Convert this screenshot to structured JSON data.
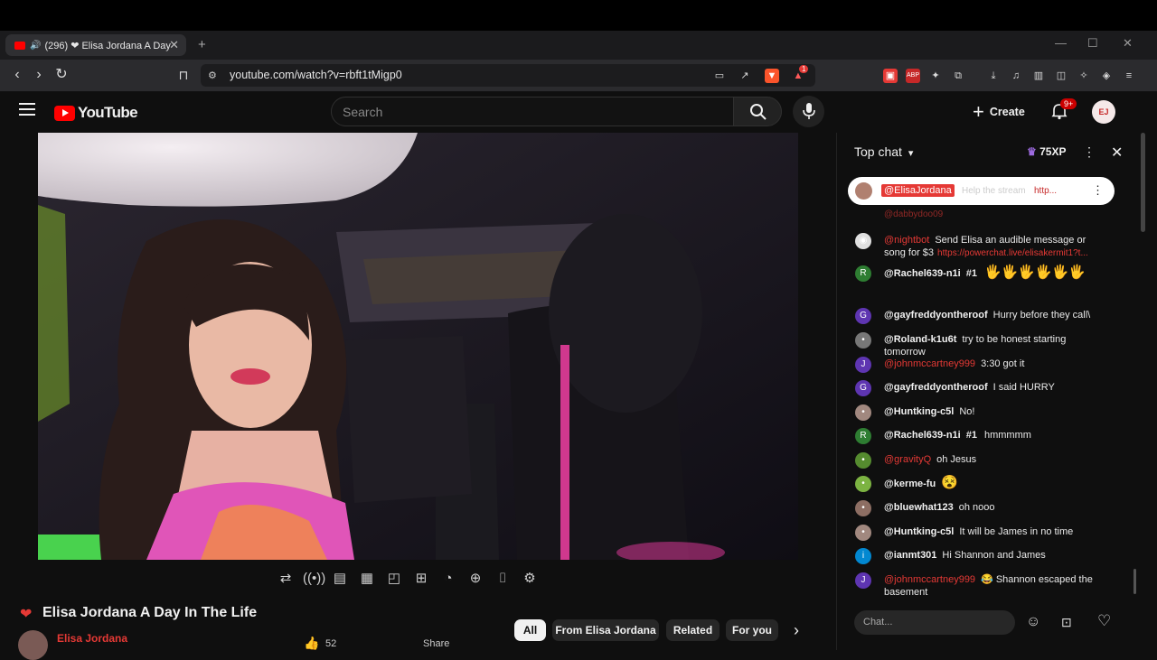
{
  "browser": {
    "tab_title": "(296) ❤ Elisa Jordana A Day",
    "url": "youtube.com/watch?v=rbft1tMigp0",
    "ext_badge": "1"
  },
  "youtube": {
    "logo_text": "YouTube",
    "search_placeholder": "Search",
    "create_label": "Create",
    "notif_badge": "9+",
    "channel_avatar_text": "EJ"
  },
  "video": {
    "title": "Elisa Jordana A Day In The Life",
    "channel_name": "Elisa Jordana",
    "like_count": "52",
    "share_label": "Share"
  },
  "filters": [
    "All",
    "From Elisa Jordana",
    "Related",
    "For you"
  ],
  "chat": {
    "mode_label": "Top chat",
    "xp_label": "75XP",
    "pinned": {
      "author": "@ElisaJordana",
      "text": "Help the stream",
      "link": "http..."
    },
    "partial_top": "@dabbydoo09",
    "messages": [
      {
        "avatar": "◉",
        "avatar_color": "#e0e0e0",
        "author": "@nightbot",
        "author_red": true,
        "text": "Send Elisa an audible message or song for $3",
        "link": "https://powerchat.live/elisakermit1?t..."
      },
      {
        "avatar": "R",
        "avatar_color": "#2e7d32",
        "author": "@Rachel639-n1i",
        "author_red": false,
        "badge": "#1",
        "text": "🖐🖐🖐🖐🖐🖐"
      },
      {
        "avatar": "G",
        "avatar_color": "#5e35b1",
        "author": "@gayfreddyontheroof",
        "author_red": false,
        "text": "Hurry before they call\\"
      },
      {
        "avatar": "•",
        "avatar_color": "#777777",
        "author": "@Roland-k1u6t",
        "author_red": false,
        "text": "try to be honest starting tomorrow"
      },
      {
        "avatar": "J",
        "avatar_color": "#5e35b1",
        "author": "@johnmccartney999",
        "author_red": true,
        "text": "3:30 got it"
      },
      {
        "avatar": "G",
        "avatar_color": "#5e35b1",
        "author": "@gayfreddyontheroof",
        "author_red": false,
        "text": "I said HURRY"
      },
      {
        "avatar": "•",
        "avatar_color": "#a1887f",
        "author": "@Huntking-c5l",
        "author_red": false,
        "text": "No!"
      },
      {
        "avatar": "R",
        "avatar_color": "#2e7d32",
        "author": "@Rachel639-n1i",
        "author_red": false,
        "badge": "#1",
        "text": "hmmmmm"
      },
      {
        "avatar": "•",
        "avatar_color": "#558b2f",
        "author": "@gravityQ",
        "author_red": true,
        "text": "oh Jesus"
      },
      {
        "avatar": "•",
        "avatar_color": "#7cb342",
        "author": "@kerme-fu",
        "author_red": false,
        "text": "😵"
      },
      {
        "avatar": "•",
        "avatar_color": "#8d6e63",
        "author": "@bluewhat123",
        "author_red": false,
        "text": "oh nooo"
      },
      {
        "avatar": "•",
        "avatar_color": "#a1887f",
        "author": "@Huntking-c5l",
        "author_red": false,
        "text": "It will be James in no time"
      },
      {
        "avatar": "i",
        "avatar_color": "#0288d1",
        "author": "@ianmt301",
        "author_red": false,
        "text": "Hi Shannon and James"
      },
      {
        "avatar": "J",
        "avatar_color": "#5e35b1",
        "author": "@johnmccartney999",
        "author_red": true,
        "text": "😂 Shannon escaped the basement"
      }
    ],
    "input_placeholder": "Chat..."
  }
}
